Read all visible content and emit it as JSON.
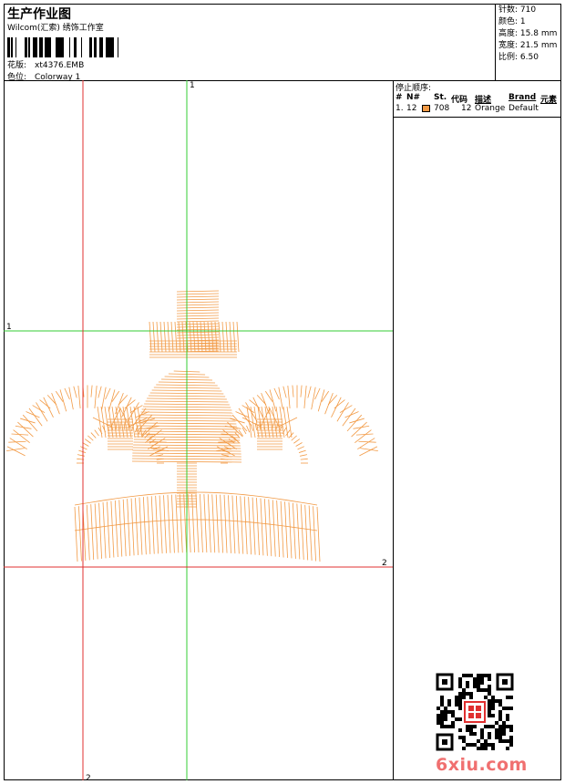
{
  "header": {
    "title": "生产作业图",
    "company": "Wilcom(汇索) 绣饰工作室",
    "design_label": "花版:",
    "design_value": "xt4376.EMB",
    "colorway_label": "色位:",
    "colorway_value": "Colorway 1"
  },
  "stats": [
    {
      "label": "针数:",
      "value": "710"
    },
    {
      "label": "颜色:",
      "value": "1"
    },
    {
      "label": "高度:",
      "value": "15.8 mm"
    },
    {
      "label": "宽度:",
      "value": "21.5 mm"
    },
    {
      "label": "比例:",
      "value": "6.50"
    }
  ],
  "canvas": {
    "guide_v1": "1",
    "guide_h1": "1",
    "guide_v2": "2",
    "guide_h2": "2",
    "green_guide_color": "#33cc33",
    "red_guide_color": "#e03030",
    "stitch_color": "#f29a45"
  },
  "stop_sequence": {
    "title": "停止顺序:",
    "headers": [
      "#",
      "N#",
      "St.",
      "代码",
      "描述",
      "Brand",
      "元素"
    ],
    "rows": [
      {
        "index": "1.",
        "needle": "12",
        "color": "#f29a45",
        "stitches": "708",
        "code": "12",
        "description": "Orange",
        "brand": "Default",
        "element": ""
      }
    ]
  },
  "watermark": {
    "qr_icon": "qr-code-icon",
    "seal_icon": "red-seal-icon",
    "site": "6xiu.com"
  }
}
